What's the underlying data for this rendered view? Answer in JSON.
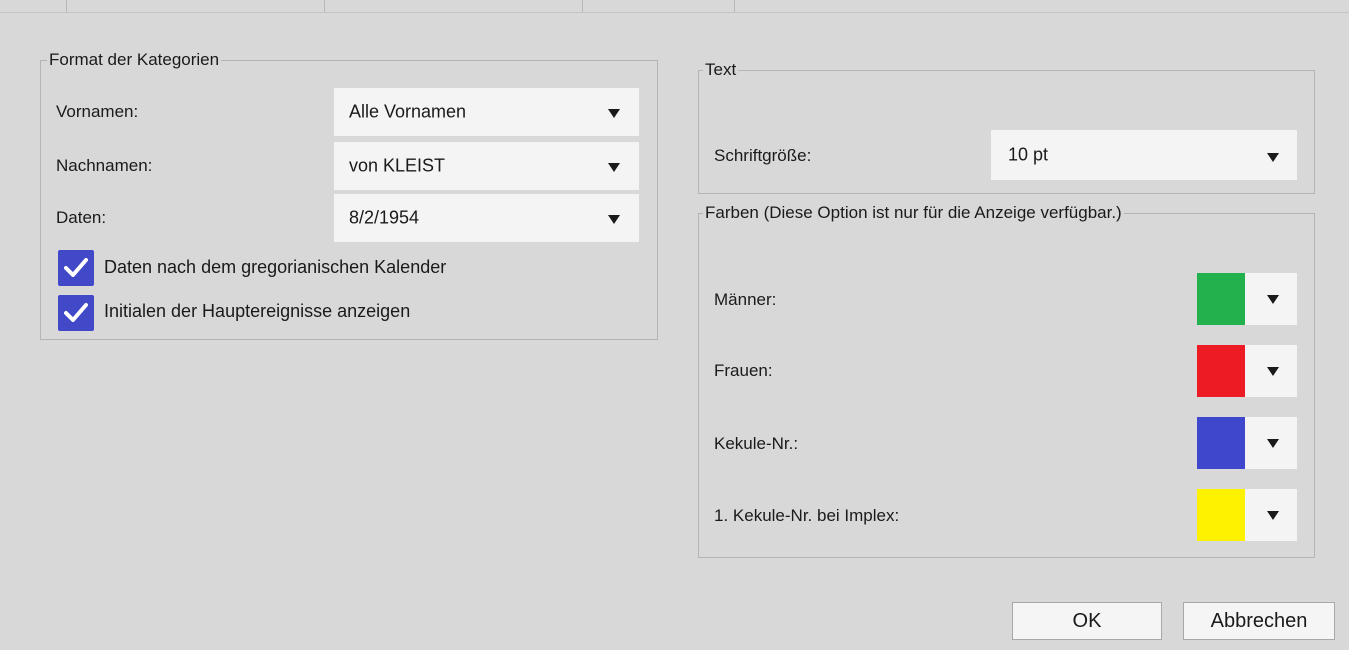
{
  "format": {
    "legend": "Format der Kategorien",
    "vornamen": {
      "label": "Vornamen:",
      "value": "Alle Vornamen"
    },
    "nachnamen": {
      "label": "Nachnamen:",
      "value": "von KLEIST"
    },
    "daten": {
      "label": "Daten:",
      "value": "8/2/1954"
    },
    "check_gregorian": {
      "label": "Daten nach dem gregorianischen Kalender",
      "checked": true
    },
    "check_initials": {
      "label": "Initialen der Hauptereignisse anzeigen",
      "checked": true
    }
  },
  "text": {
    "legend": "Text",
    "fontsize": {
      "label": "Schriftgröße:",
      "value": "10 pt"
    }
  },
  "colors": {
    "legend": "Farben (Diese Option ist nur für die Anzeige verfügbar.)",
    "items": [
      {
        "label": "Männer:",
        "color": "#22b14c"
      },
      {
        "label": "Frauen:",
        "color": "#ed1c24"
      },
      {
        "label": "Kekule-Nr.:",
        "color": "#3f48cc"
      },
      {
        "label": "1. Kekule-Nr. bei Implex:",
        "color": "#fff200"
      }
    ]
  },
  "buttons": {
    "ok": "OK",
    "cancel": "Abbrechen"
  },
  "theme": {
    "checkbox": "#4149c9",
    "background": "#d8d8d8"
  }
}
